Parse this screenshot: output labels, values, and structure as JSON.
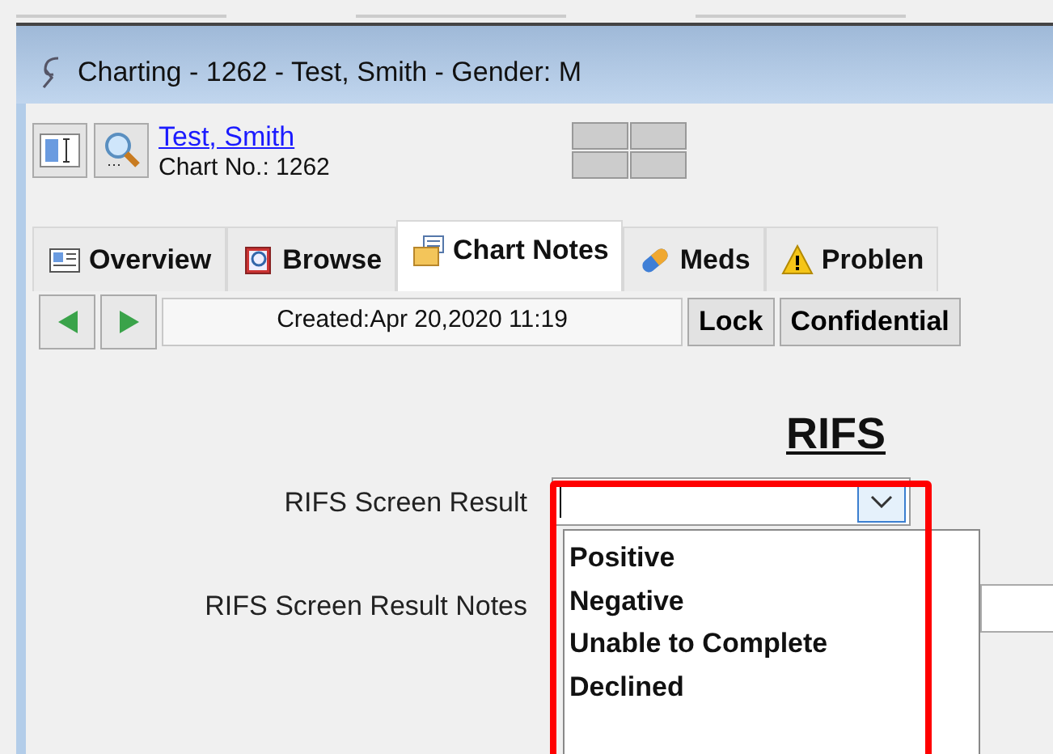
{
  "window": {
    "title": "Charting - 1262 - Test, Smith - Gender: M"
  },
  "patient": {
    "name": "Test, Smith",
    "chart_no": "Chart No.: 1262"
  },
  "tabs": [
    {
      "label": "Overview",
      "selected": false
    },
    {
      "label": "Browse",
      "selected": false
    },
    {
      "label": "Chart Notes",
      "selected": true
    },
    {
      "label": "Meds",
      "selected": false
    },
    {
      "label": "Problen",
      "selected": false
    }
  ],
  "toolbar": {
    "created": "Created:Apr 20,2020 11:19",
    "buttons": [
      "Lock",
      "Confidential"
    ]
  },
  "form": {
    "heading": "RIFS",
    "fields": [
      {
        "label": "RIFS Screen Result",
        "kind": "combo",
        "expanded": true,
        "options": [
          "Positive",
          "Negative",
          "Unable to Complete",
          "Declined"
        ]
      },
      {
        "label": "RIFS Screen Result Notes",
        "kind": "text"
      }
    ]
  }
}
